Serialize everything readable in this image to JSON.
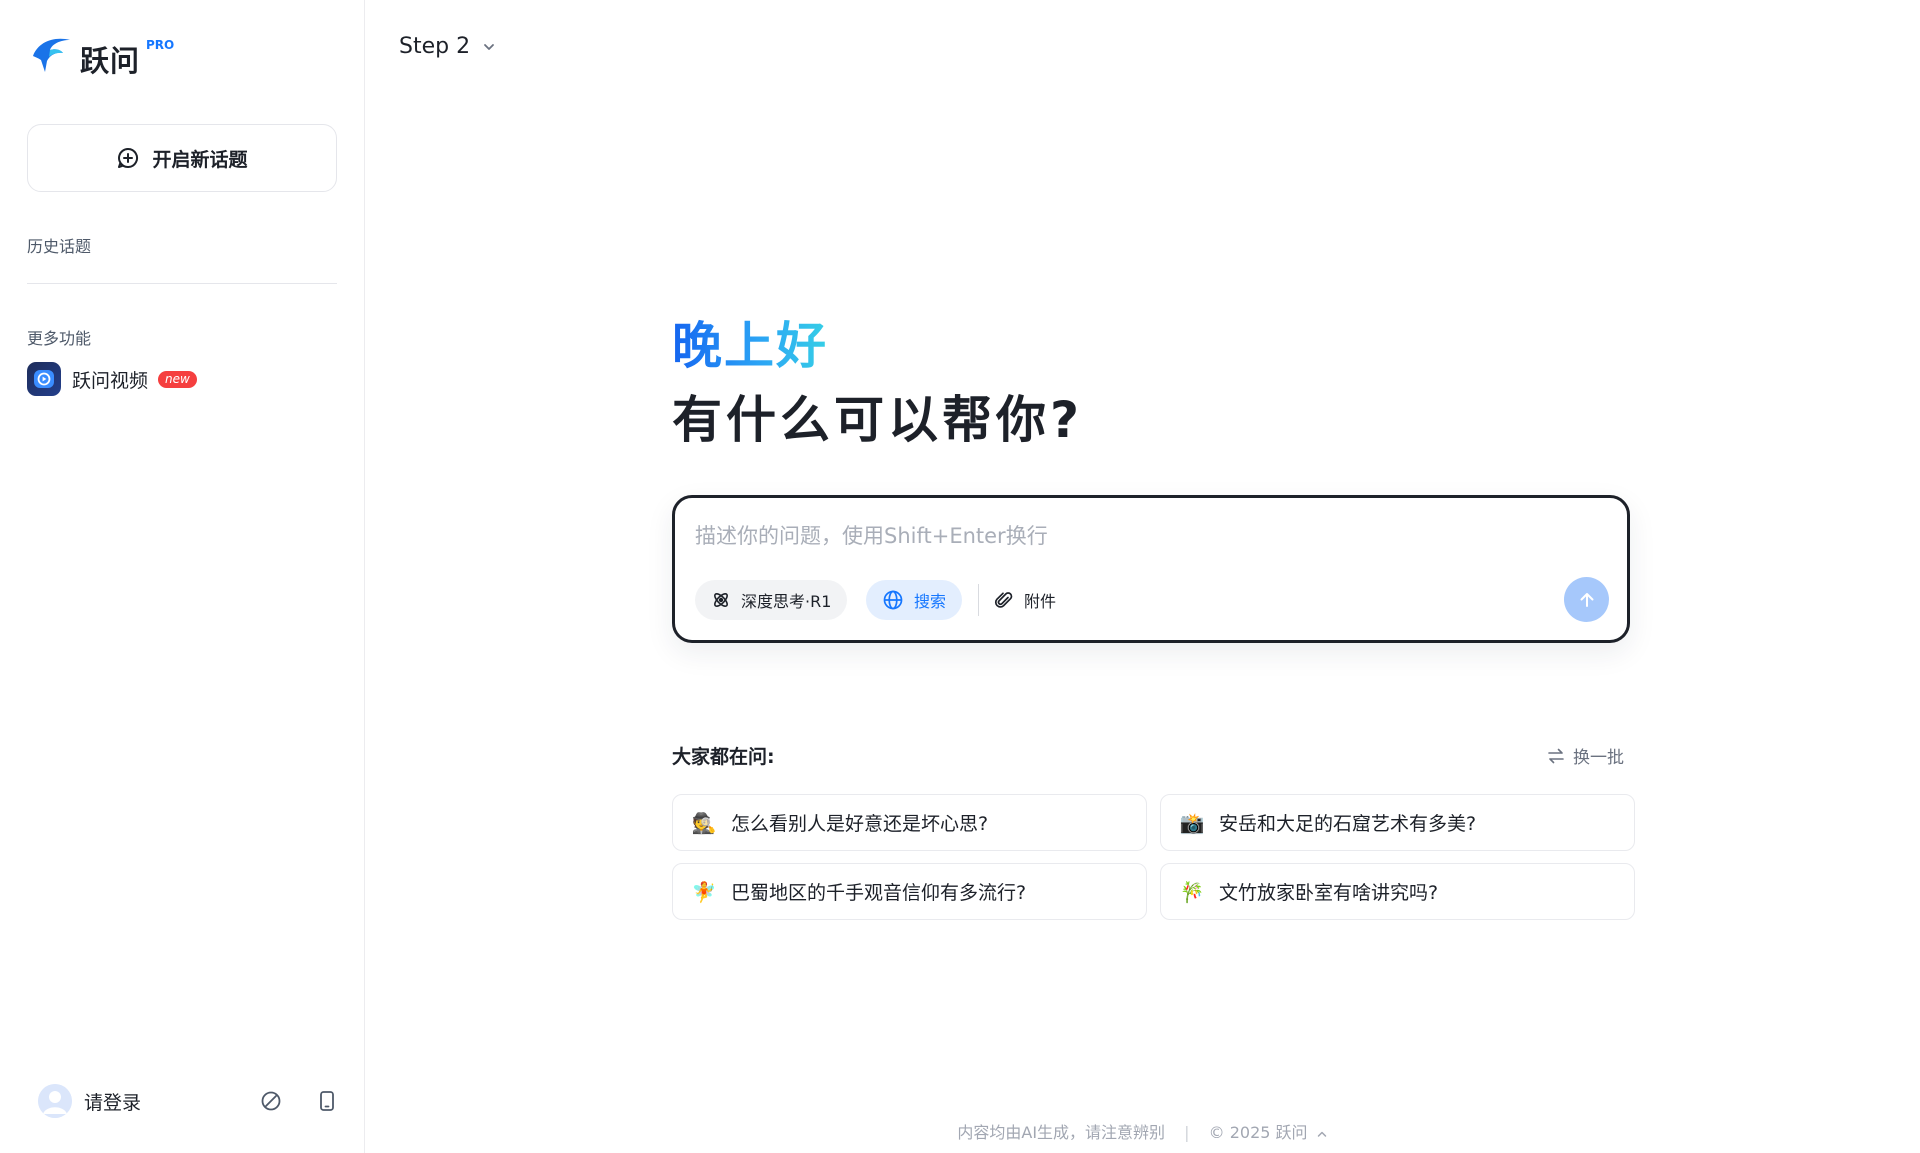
{
  "brand": {
    "name": "跃问",
    "badge": "PRO",
    "accent": "#1677ff"
  },
  "sidebar": {
    "new_topic_label": "开启新话题",
    "history_label": "历史话题",
    "more_label": "更多功能",
    "features": [
      {
        "icon": "video-play-icon",
        "label": "跃问视频",
        "badge": "new"
      }
    ],
    "footer": {
      "login_label": "请登录",
      "icons": [
        "note-icon",
        "phone-icon"
      ]
    }
  },
  "main": {
    "model_selector": {
      "label": "Step 2",
      "icon": "chevron-down-icon"
    },
    "greeting": "晚上好",
    "headline": "有什么可以帮你?",
    "composer": {
      "placeholder": "描述你的问题，使用Shift+Enter换行",
      "think_label": "深度思考·R1",
      "search_label": "搜索",
      "attach_label": "附件",
      "send_icon": "arrow-up-icon"
    },
    "asking": {
      "title": "大家都在问:",
      "refresh_label": "换一批",
      "items": [
        {
          "emoji": "🕵",
          "text": "怎么看别人是好意还是坏心思?"
        },
        {
          "emoji": "📸",
          "text": "安岳和大足的石窟艺术有多美?"
        },
        {
          "emoji": "🧚",
          "text": "巴蜀地区的千手观音信仰有多流行?"
        },
        {
          "emoji": "🎋",
          "text": "文竹放家卧室有啥讲究吗?"
        }
      ]
    },
    "footer": {
      "disclaimer": "内容均由AI生成，请注意辨别",
      "copyright": "© 2025 跃问"
    }
  }
}
